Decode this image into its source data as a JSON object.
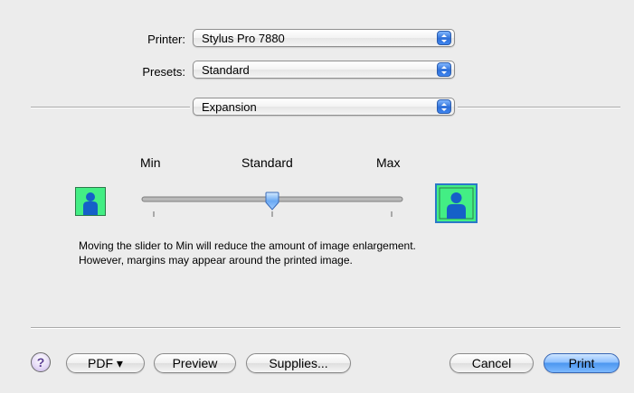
{
  "printer": {
    "label": "Printer:",
    "value": "Stylus Pro 7880"
  },
  "presets": {
    "label": "Presets:",
    "value": "Standard"
  },
  "panel": {
    "value": "Expansion"
  },
  "slider": {
    "min_label": "Min",
    "mid_label": "Standard",
    "max_label": "Max",
    "level": 0.5
  },
  "description": {
    "line1": "Moving the slider to Min will reduce the amount of image enlargement.",
    "line2": "However, margins may appear around the printed image."
  },
  "buttons": {
    "help": "?",
    "pdf": "PDF ▾",
    "preview": "Preview",
    "supplies": "Supplies...",
    "cancel": "Cancel",
    "print": "Print"
  },
  "colors": {
    "accent": "#3f86f0",
    "thumbnail_bg": "#43ee84",
    "figure": "#1560c8"
  }
}
